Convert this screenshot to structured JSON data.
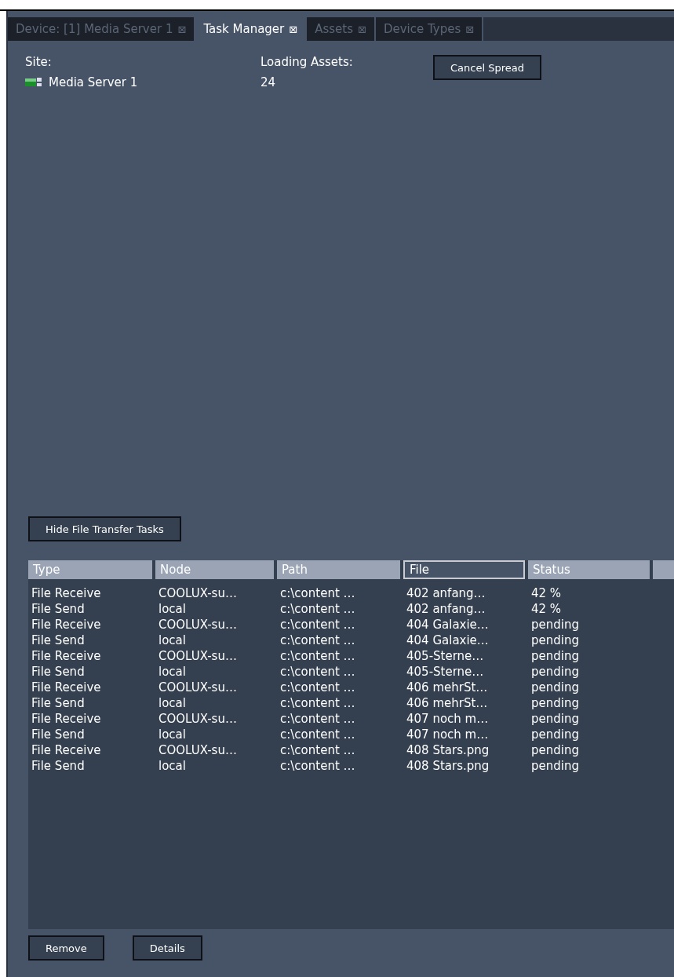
{
  "tabs": [
    {
      "label": "Device: [1] Media Server 1",
      "close": "⊠",
      "selected": false
    },
    {
      "label": "Task Manager",
      "close": "⊠",
      "selected": true
    },
    {
      "label": "Assets",
      "close": "⊠",
      "selected": false
    },
    {
      "label": "Device Types",
      "close": "⊠",
      "selected": false
    }
  ],
  "site": {
    "label": "Site:",
    "value": "Media Server 1"
  },
  "loading": {
    "label": "Loading Assets:",
    "value": "24"
  },
  "cancel_button": "Cancel Spread",
  "hide_button": "Hide File Transfer Tasks",
  "table": {
    "columns": [
      {
        "label": "Type",
        "selected": false
      },
      {
        "label": "Node",
        "selected": false
      },
      {
        "label": "Path",
        "selected": false
      },
      {
        "label": "File",
        "selected": true
      },
      {
        "label": "Status",
        "selected": false
      }
    ],
    "rows": [
      [
        "File Receive",
        "COOLUX-su…",
        "c:\\content …",
        "402 anfang…",
        "42 %"
      ],
      [
        "File Send",
        "local",
        "c:\\content …",
        "402 anfang…",
        "42 %"
      ],
      [
        "File Receive",
        "COOLUX-su…",
        "c:\\content …",
        "404 Galaxie…",
        "pending"
      ],
      [
        "File Send",
        "local",
        "c:\\content …",
        "404 Galaxie…",
        "pending"
      ],
      [
        "File Receive",
        "COOLUX-su…",
        "c:\\content …",
        "405-Sterne…",
        "pending"
      ],
      [
        "File Send",
        "local",
        "c:\\content …",
        "405-Sterne…",
        "pending"
      ],
      [
        "File Receive",
        "COOLUX-su…",
        "c:\\content …",
        "406 mehrSt…",
        "pending"
      ],
      [
        "File Send",
        "local",
        "c:\\content …",
        "406 mehrSt…",
        "pending"
      ],
      [
        "File Receive",
        "COOLUX-su…",
        "c:\\content …",
        "407 noch m…",
        "pending"
      ],
      [
        "File Send",
        "local",
        "c:\\content …",
        "407 noch m…",
        "pending"
      ],
      [
        "File Receive",
        "COOLUX-su…",
        "c:\\content …",
        "408 Stars.png",
        "pending"
      ],
      [
        "File Send",
        "local",
        "c:\\content …",
        "408 Stars.png",
        "pending"
      ]
    ]
  },
  "bottom_buttons": [
    "Remove",
    "Details"
  ]
}
